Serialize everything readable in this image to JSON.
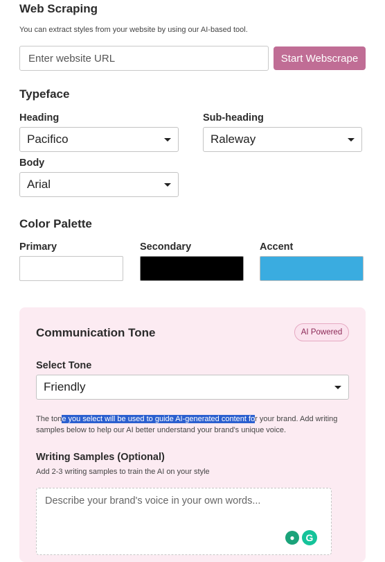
{
  "web_scraping": {
    "title": "Web Scraping",
    "description": "You can extract styles from your website by using our AI-based tool.",
    "url_placeholder": "Enter website URL",
    "start_button": "Start Webscrape"
  },
  "typeface": {
    "title": "Typeface",
    "heading_label": "Heading",
    "heading_value": "Pacifico",
    "subheading_label": "Sub-heading",
    "subheading_value": "Raleway",
    "body_label": "Body",
    "body_value": "Arial"
  },
  "color_palette": {
    "title": "Color Palette",
    "primary_label": "Primary",
    "primary_color": "#ffffff",
    "secondary_label": "Secondary",
    "secondary_color": "#000000",
    "accent_label": "Accent",
    "accent_color": "#3aace0"
  },
  "communication_tone": {
    "title": "Communication Tone",
    "badge": "AI Powered",
    "select_label": "Select Tone",
    "select_value": "Friendly",
    "help_pre": "The ton",
    "help_highlight": "e you select will be used to guide AI-generated content fo",
    "help_post": "r your brand. Add writing samples below to help our AI better understand your brand's unique voice.",
    "samples_title": "Writing Samples (Optional)",
    "samples_hint": "Add 2-3 writing samples to train the AI on your style",
    "samples_placeholder": "Describe your brand's voice in your own words..."
  },
  "icons": {
    "caret": "chevron-down-icon",
    "grammarly_bulb": "lightbulb-icon",
    "grammarly_logo": "grammarly-g-icon"
  }
}
